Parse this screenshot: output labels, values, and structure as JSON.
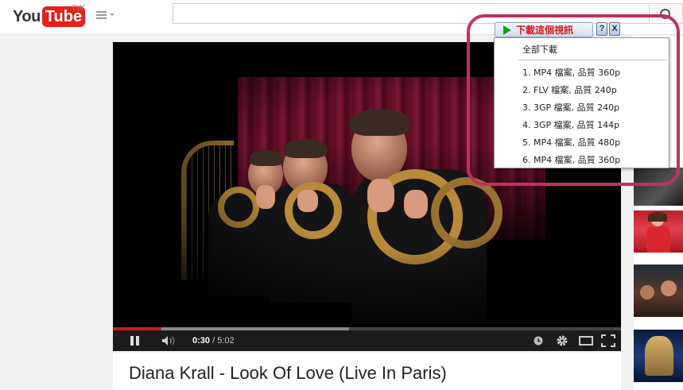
{
  "header": {
    "logo_you": "You",
    "logo_tube": "Tube",
    "logo_region": "TW",
    "search_value": ""
  },
  "player": {
    "current_time": "0:30",
    "time_separator": " / ",
    "duration": "5:02",
    "played_fraction": 0.096,
    "buffered_fraction": 0.465
  },
  "video": {
    "title": "Diana Krall - Look Of Love (Live In Paris)"
  },
  "downloader": {
    "button_label": "下載這個視訊",
    "help_label": "?",
    "close_label": "X",
    "download_all": "全部下載",
    "options": [
      "1. MP4 檔案, 品質 360p",
      "2. FLV 檔案, 品質 240p",
      "3. 3GP 檔案, 品質 240p",
      "4. 3GP 檔案, 品質 144p",
      "5. MP4 檔案, 品質 480p",
      "6. MP4 檔案, 品質 360p"
    ]
  },
  "colors": {
    "brand_red": "#e62117",
    "progress_red": "#cc181e",
    "highlight_ring": "#c2305d",
    "download_label": "#d41818"
  }
}
